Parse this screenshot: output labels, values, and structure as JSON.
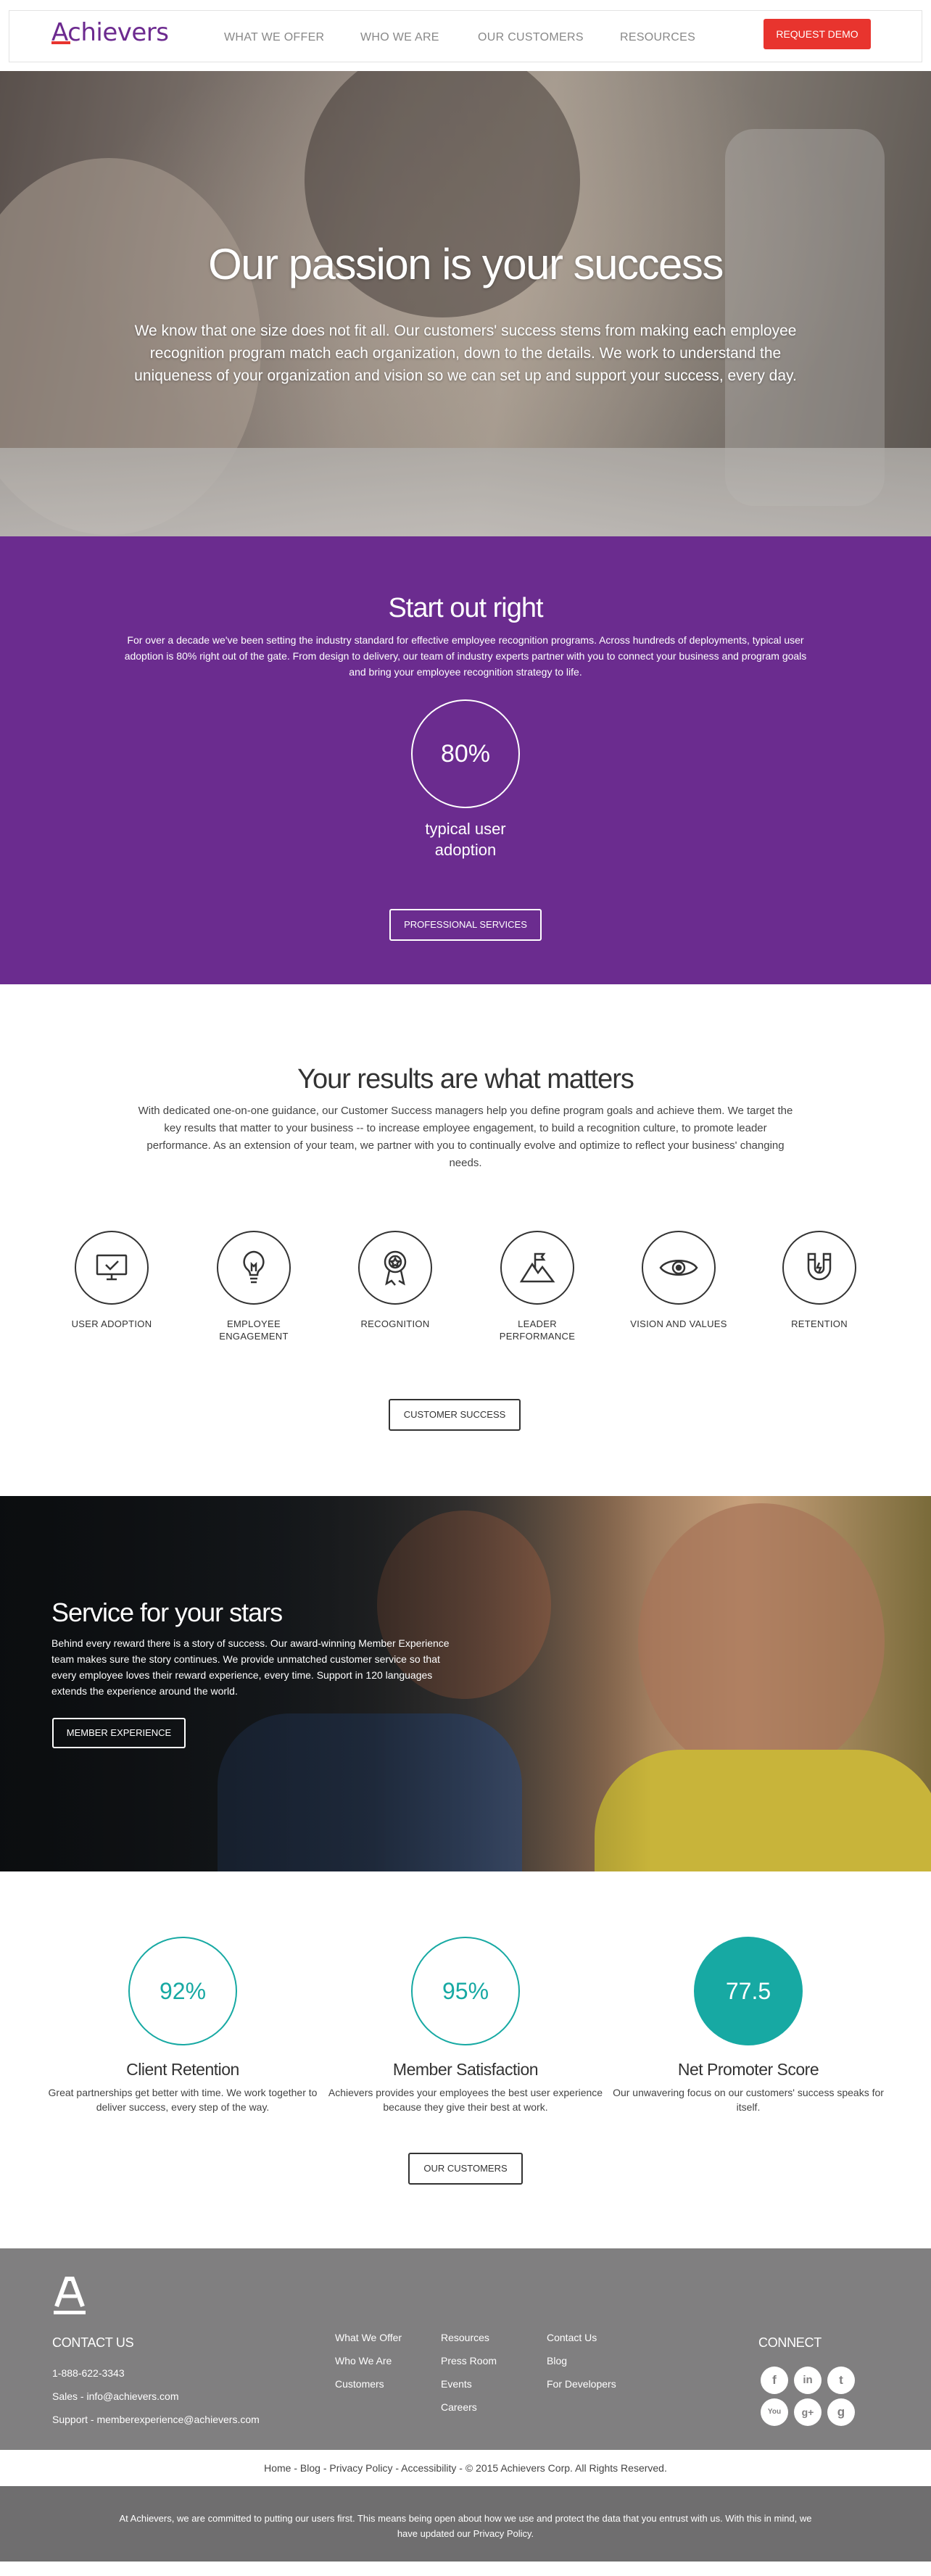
{
  "header": {
    "logo_text": "Achievers",
    "nav": [
      "WHAT WE OFFER",
      "WHO WE ARE",
      "OUR CUSTOMERS",
      "RESOURCES"
    ],
    "cta_label": "REQUEST DEMO",
    "brand_color": "#6b2c8f",
    "accent_color": "#e8342e"
  },
  "hero": {
    "title": "Our passion is your success",
    "body": "We know that one size does not fit all. Our customers' success stems from making each employee recognition program match each organization, down to the details. We work to understand the uniqueness of your organization and vision so we can set up and support your success, every day."
  },
  "start_right": {
    "title": "Start out right",
    "body": "For over a decade we've been setting the industry standard for effective employee recognition programs. Across hundreds of deployments, typical user adoption is 80% right out of the gate. From design to delivery, our team of industry experts partner with you to connect your business and program goals and bring your employee recognition strategy to life.",
    "stat_value": "80%",
    "stat_label": "typical user adoption",
    "button_label": "PROFESSIONAL SERVICES"
  },
  "results": {
    "title": "Your results are what matters",
    "body": "With dedicated one-on-one guidance, our Customer Success managers help you define program goals and achieve them. We target the key results that matter to your business -- to increase employee engagement, to build a recognition culture, to promote leader performance. As an extension of your team, we partner with you to continually evolve and optimize to reflect your business' changing needs.",
    "items": [
      {
        "label": "USER ADOPTION",
        "icon": "monitor-check-icon"
      },
      {
        "label": "EMPLOYEE ENGAGEMENT",
        "icon": "lightbulb-icon"
      },
      {
        "label": "RECOGNITION",
        "icon": "award-ribbon-icon"
      },
      {
        "label": "LEADER PERFORMANCE",
        "icon": "mountain-flag-icon"
      },
      {
        "label": "VISION AND VALUES",
        "icon": "eye-icon"
      },
      {
        "label": "RETENTION",
        "icon": "magnet-icon"
      }
    ],
    "button_label": "CUSTOMER SUCCESS"
  },
  "service": {
    "title": "Service for your stars",
    "body": "Behind every reward there is a story of success. Our award-winning Member Experience team makes sure the story continues. We provide unmatched customer service so that every employee loves their reward experience, every time. Support in 120 languages extends the experience around the world.",
    "button_label": "MEMBER EXPERIENCE"
  },
  "stats": {
    "teal_color": "#17a9a3",
    "items": [
      {
        "value": "92%",
        "title": "Client Retention",
        "desc": "Great partnerships get better with time. We work together to deliver success, every step of the way."
      },
      {
        "value": "95%",
        "title": "Member Satisfaction",
        "desc": "Achievers provides your employees the best user experience because they give their best at work."
      },
      {
        "value": "77.5",
        "title": "Net Promoter Score",
        "desc": "Our unwavering focus on our customers' success speaks for itself."
      }
    ],
    "button_label": "OUR CUSTOMERS"
  },
  "footer": {
    "contact_title": "CONTACT US",
    "phone": "1-888-622-3343",
    "sales": "Sales - info@achievers.com",
    "support": "Support - memberexperience@achievers.com",
    "col1": [
      "What We Offer",
      "Who We Are",
      "Customers"
    ],
    "col2": [
      "Resources",
      "Press Room",
      "Events",
      "Careers"
    ],
    "col3": [
      "Contact Us",
      "Blog",
      "For Developers"
    ],
    "connect_title": "CONNECT",
    "social": [
      {
        "name": "facebook-icon",
        "glyph": "f"
      },
      {
        "name": "linkedin-icon",
        "glyph": "in"
      },
      {
        "name": "twitter-icon",
        "glyph": "t"
      },
      {
        "name": "youtube-icon",
        "glyph": "You"
      },
      {
        "name": "google-plus-icon",
        "glyph": "g+"
      },
      {
        "name": "glassdoor-icon",
        "glyph": "g"
      }
    ]
  },
  "legal": {
    "links": "Home - Blog - Privacy Policy - Accessibility - © 2015 Achievers Corp. All Rights Reserved."
  },
  "notice": {
    "text": "At Achievers, we are committed to putting our users first. This means being open about how we use and protect the data that you entrust with us. With this in mind, we have updated our Privacy Policy."
  }
}
